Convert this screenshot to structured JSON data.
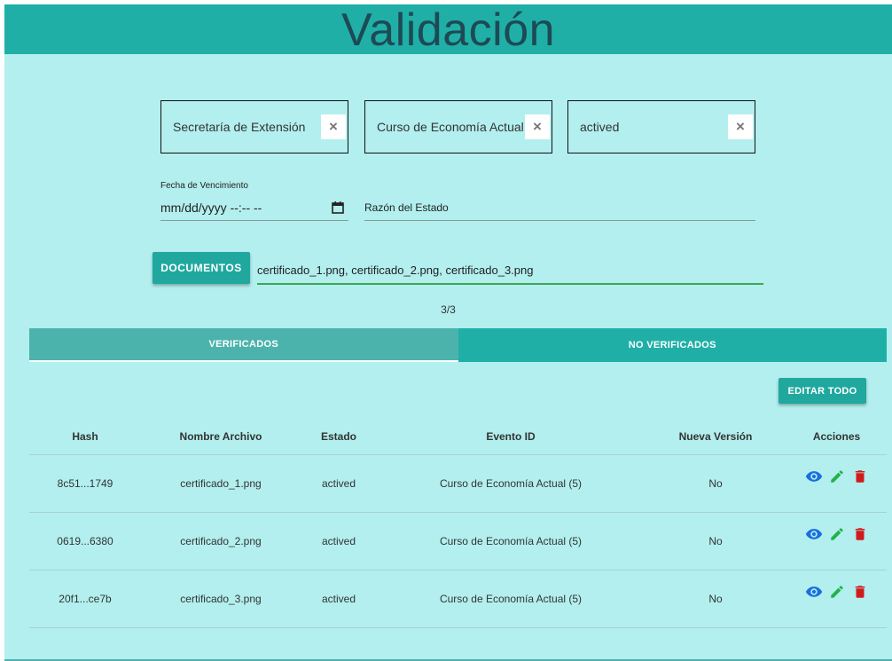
{
  "header": {
    "title": "Validación"
  },
  "filters": {
    "chips": [
      {
        "label": "Secretaría de Extensión",
        "remove": "×"
      },
      {
        "label": "Curso de Economía Actual",
        "remove": "×"
      },
      {
        "label": "actived",
        "remove": "×"
      }
    ],
    "expiry_label": "Fecha de Vencimiento",
    "expiry_value": "mm/dd/yyyy --:-- --",
    "status_reason_label": "Razón del Estado"
  },
  "documents": {
    "button_label": "DOCUMENTOS",
    "files_value": "certificado_1.png, certificado_2.png, certificado_3.png",
    "count": "3/3"
  },
  "tabs": [
    {
      "label": "VERIFICADOS",
      "active": true
    },
    {
      "label": "NO VERIFICADOS",
      "active": false
    }
  ],
  "edit_all_label": "EDITAR TODO",
  "table": {
    "columns": [
      "Hash",
      "Nombre Archivo",
      "Estado",
      "Evento ID",
      "Nueva Versión",
      "Acciones"
    ],
    "rows": [
      {
        "hash": "8c51...1749",
        "file": "certificado_1.png",
        "status": "actived",
        "event": "Curso de Economía Actual (5)",
        "new_version": "No"
      },
      {
        "hash": "0619...6380",
        "file": "certificado_2.png",
        "status": "actived",
        "event": "Curso de Economía Actual (5)",
        "new_version": "No"
      },
      {
        "hash": "20f1...ce7b",
        "file": "certificado_3.png",
        "status": "actived",
        "event": "Curso de Economía Actual (5)",
        "new_version": "No"
      }
    ],
    "action_icons": [
      "eye-icon",
      "pencil-icon",
      "trash-icon"
    ]
  },
  "colors": {
    "background": "#b2efee",
    "header": "#20afa7",
    "title": "#1d4a55",
    "button": "#20a89f",
    "view_icon": "#1a6ee0",
    "edit_icon": "#22b24c",
    "delete_icon": "#d11a1a"
  }
}
